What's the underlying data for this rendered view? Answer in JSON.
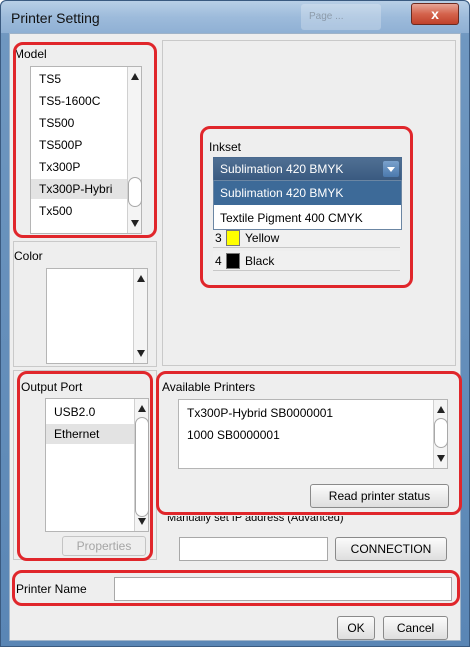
{
  "window": {
    "title": "Printer Setting",
    "close_label": "x",
    "blurred_tab": "Page ..."
  },
  "model": {
    "label": "Model",
    "items": [
      "TS5",
      "TS5-1600C",
      "TS500",
      "TS500P",
      "Tx300P",
      "Tx300P-Hybri",
      "Tx500"
    ],
    "selected": "Tx300P-Hybri"
  },
  "color": {
    "label": "Color"
  },
  "inkset": {
    "label": "Inkset",
    "selected": "Sublimation 420 BMYK",
    "options": [
      "Sublimation 420 BMYK",
      "Textile Pigment 400 CMYK"
    ],
    "inks": [
      {
        "num": "3",
        "name": "Yellow",
        "color": "#ffff00"
      },
      {
        "num": "4",
        "name": "Black",
        "color": "#000000"
      }
    ]
  },
  "output_port": {
    "label": "Output Port",
    "items": [
      "USB2.0",
      "Ethernet"
    ],
    "selected": "Ethernet",
    "properties_label": "Properties"
  },
  "available_printers": {
    "label": "Available Printers",
    "items": [
      "Tx300P-Hybrid SB0000001",
      "1000 SB0000001"
    ],
    "read_status_label": "Read printer status"
  },
  "manual_ip": {
    "label": "Manually set IP address (Advanced)",
    "value": "",
    "connection_label": "CONNECTION"
  },
  "printer_name": {
    "label": "Printer Name",
    "value": ""
  },
  "footer": {
    "ok_label": "OK",
    "cancel_label": "Cancel"
  },
  "colors": {
    "highlight_red": "#e0262b",
    "selection_blue": "#3d6a98"
  }
}
